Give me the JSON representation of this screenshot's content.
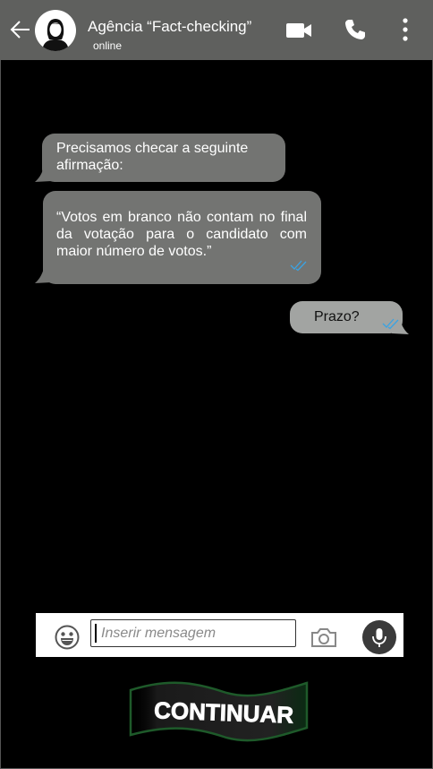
{
  "header": {
    "title": "Agência “Fact-checking”",
    "status": "online",
    "background": "#5f605e"
  },
  "messages": [
    {
      "text": "Precisamos checar a seguinte afirmação:",
      "direction": "incoming"
    },
    {
      "text": "“Votos em branco não contam no final da votação para o candidato com maior número de votos.”",
      "direction": "incoming",
      "read_check": "double-check-icon"
    },
    {
      "text": "Prazo?",
      "direction": "outgoing",
      "read_check": "double-check-icon"
    }
  ],
  "input": {
    "placeholder": "Inserir mensagem",
    "value": ""
  },
  "continue_button": {
    "label": "CONTINUAR",
    "color": "#1e5a2a"
  },
  "colors": {
    "incoming_bubble": "#737472",
    "outgoing_bubble": "#a2a4a2",
    "check": "#3aa3e3"
  }
}
